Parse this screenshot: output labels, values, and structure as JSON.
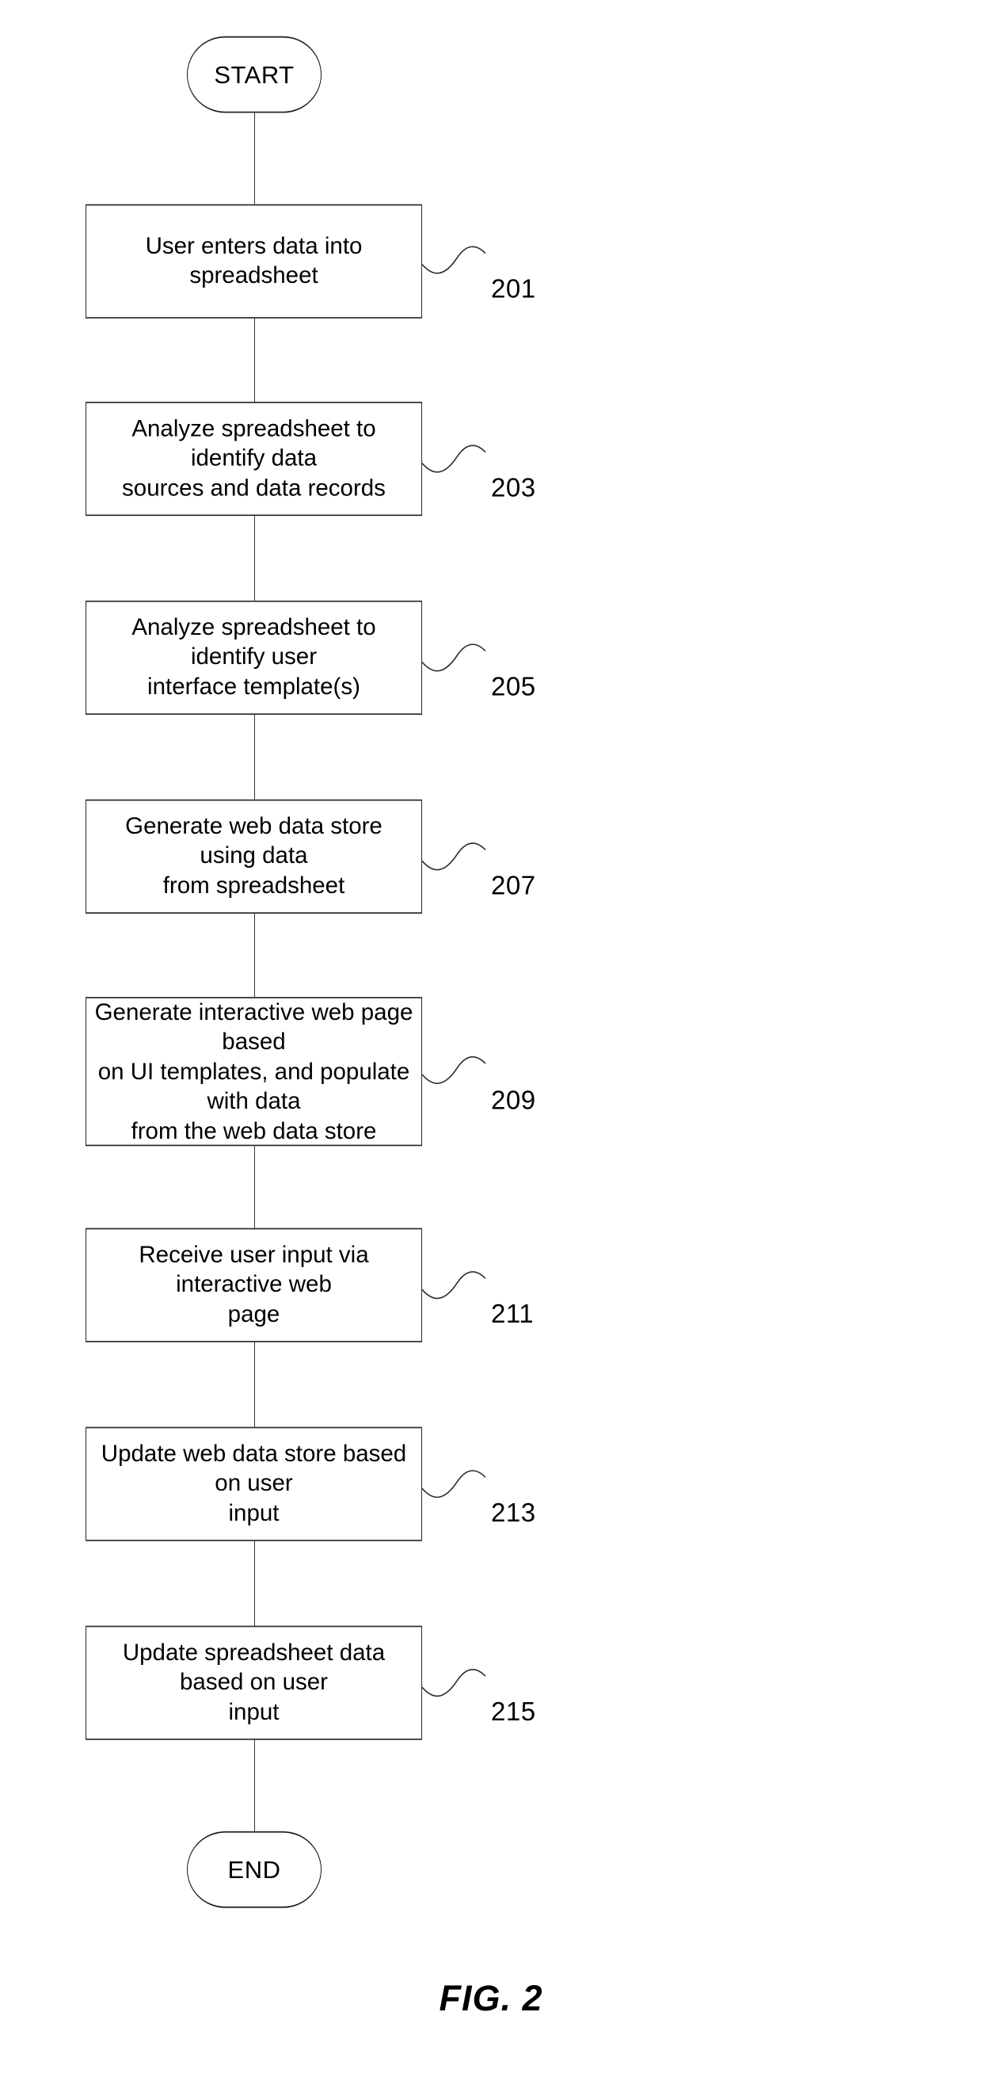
{
  "figure": {
    "caption": "FIG. 2",
    "start_label": "START",
    "end_label": "END"
  },
  "chart_data": {
    "type": "diagram",
    "diagram_type": "flowchart",
    "orientation": "vertical",
    "title": "FIG. 2",
    "nodes": [
      {
        "id": "start",
        "shape": "terminal",
        "label": "START"
      },
      {
        "id": "s201",
        "shape": "process",
        "ref": "201",
        "label": "User enters data into spreadsheet"
      },
      {
        "id": "s203",
        "shape": "process",
        "ref": "203",
        "label": "Analyze spreadsheet to identify data\nsources and data records"
      },
      {
        "id": "s205",
        "shape": "process",
        "ref": "205",
        "label": "Analyze spreadsheet to identify user\ninterface template(s)"
      },
      {
        "id": "s207",
        "shape": "process",
        "ref": "207",
        "label": "Generate web data store using data\nfrom spreadsheet"
      },
      {
        "id": "s209",
        "shape": "process",
        "ref": "209",
        "label": "Generate interactive web page based\non UI templates, and populate with data\nfrom the web data store"
      },
      {
        "id": "s211",
        "shape": "process",
        "ref": "211",
        "label": "Receive user input via interactive web\npage"
      },
      {
        "id": "s213",
        "shape": "process",
        "ref": "213",
        "label": "Update web data store based on user\ninput"
      },
      {
        "id": "s215",
        "shape": "process",
        "ref": "215",
        "label": "Update spreadsheet data based on user\ninput"
      },
      {
        "id": "end",
        "shape": "terminal",
        "label": "END"
      }
    ],
    "edges": [
      {
        "from": "start",
        "to": "s201"
      },
      {
        "from": "s201",
        "to": "s203"
      },
      {
        "from": "s203",
        "to": "s205"
      },
      {
        "from": "s205",
        "to": "s207"
      },
      {
        "from": "s207",
        "to": "s209"
      },
      {
        "from": "s209",
        "to": "s211"
      },
      {
        "from": "s211",
        "to": "s213"
      },
      {
        "from": "s213",
        "to": "s215"
      },
      {
        "from": "s215",
        "to": "end"
      }
    ],
    "reference_numerals": [
      "201",
      "203",
      "205",
      "207",
      "209",
      "211",
      "213",
      "215"
    ]
  },
  "steps": [
    {
      "label": "User enters data into spreadsheet",
      "ref": "201"
    },
    {
      "label": "Analyze spreadsheet to identify data\nsources and data records",
      "ref": "203"
    },
    {
      "label": "Analyze spreadsheet to identify user\ninterface template(s)",
      "ref": "205"
    },
    {
      "label": "Generate web data store using data\nfrom spreadsheet",
      "ref": "207"
    },
    {
      "label": "Generate interactive web page based\non UI templates, and populate with data\nfrom the web data store",
      "ref": "209"
    },
    {
      "label": "Receive user input via interactive web\npage",
      "ref": "211"
    },
    {
      "label": "Update web data store based on user\ninput",
      "ref": "213"
    },
    {
      "label": "Update spreadsheet data based on user\ninput",
      "ref": "215"
    }
  ],
  "colors": {
    "stroke": "#2b2b2b",
    "text": "#000000",
    "background": "#ffffff"
  }
}
